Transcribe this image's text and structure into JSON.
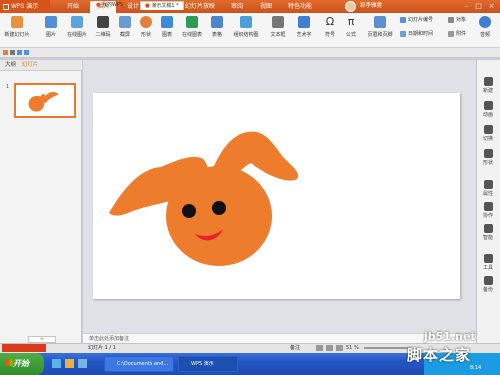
{
  "app": {
    "title": "WPS 演示",
    "user": "和李雅雯"
  },
  "menu": {
    "tabs": [
      "开始",
      "插入",
      "设计",
      "动画",
      "幻灯片放映",
      "审阅",
      "视图",
      "特色功能"
    ],
    "active": "插入"
  },
  "ribbon": {
    "buttons": [
      {
        "label": "新建幻灯片",
        "icon": "new-slide-icon"
      },
      {
        "label": "图片",
        "icon": "picture-icon"
      },
      {
        "label": "在线图片",
        "icon": "online-picture-icon"
      },
      {
        "label": "二维码",
        "icon": "qrcode-icon"
      },
      {
        "label": "截屏",
        "icon": "screenshot-icon"
      },
      {
        "label": "形状",
        "icon": "shape-icon"
      },
      {
        "label": "图表",
        "icon": "chart-icon"
      },
      {
        "label": "在线图表",
        "icon": "online-chart-icon"
      },
      {
        "label": "表格",
        "icon": "table-icon"
      },
      {
        "label": "组织结构图",
        "icon": "org-chart-icon"
      },
      {
        "label": "文本框",
        "icon": "textbox-icon"
      },
      {
        "label": "艺术字",
        "icon": "wordart-icon"
      },
      {
        "label": "符号",
        "icon": "omega-icon"
      },
      {
        "label": "公式",
        "icon": "pi-icon"
      },
      {
        "label": "页眉和页脚",
        "icon": "header-footer-icon"
      }
    ],
    "small_items": [
      {
        "label": "幻灯片编号",
        "icon": "slide-number-icon"
      },
      {
        "label": "对象",
        "icon": "object-icon"
      },
      {
        "label": "日期和时间",
        "icon": "date-time-icon"
      },
      {
        "label": "附件",
        "icon": "attachment-icon"
      }
    ],
    "audio_label": "音频"
  },
  "doc_tabs": {
    "home": "我的WPS",
    "current": "演示文稿1 *"
  },
  "left_panel": {
    "outline_tab": "大纲",
    "slides_tab": "幻灯片",
    "slide_number": "1"
  },
  "task_pane": [
    "新建",
    "动画",
    "切换",
    "形状",
    "属性",
    "协作",
    "智能",
    "工具",
    "备份"
  ],
  "notes_placeholder": "单击此处添加备注",
  "status": {
    "slide_info": "幻灯片 1 / 1",
    "notes_label": "备注",
    "zoom": "51 %"
  },
  "taskbar": {
    "start_label": "开始",
    "items": [
      "C:\\Documents and...",
      "WPS 演示"
    ],
    "tray_time": "8:14"
  },
  "watermark": {
    "site": "jb51.net",
    "name": "脚本之家"
  },
  "colors": {
    "accent": "#e8792d",
    "title_bar": "#d7531a",
    "character": "#ee7c2d"
  }
}
